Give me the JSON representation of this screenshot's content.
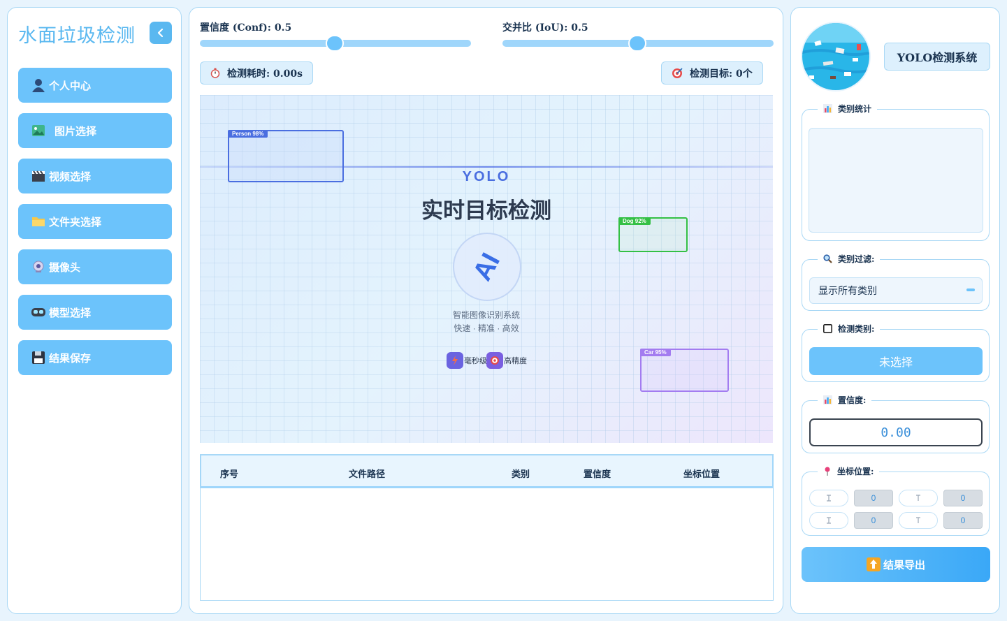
{
  "sidebar": {
    "title": "水面垃圾检测",
    "items": [
      {
        "label": "个人中心",
        "icon": "user-icon"
      },
      {
        "label": "图片选择",
        "icon": "image-icon"
      },
      {
        "label": "视频选择",
        "icon": "clapperboard-icon"
      },
      {
        "label": "文件夹选择",
        "icon": "folder-icon"
      },
      {
        "label": "摄像头",
        "icon": "webcam-icon"
      },
      {
        "label": "模型选择",
        "icon": "vr-headset-icon"
      },
      {
        "label": "结果保存",
        "icon": "floppy-disk-icon"
      }
    ]
  },
  "controls": {
    "conf_label": "置信度 (Conf): 0.5",
    "conf_value": 0.5,
    "iou_label": "交并比 (IoU): 0.5",
    "iou_value": 0.5,
    "time_label": "检测耗时: 0.00s",
    "target_label": "检测目标: 0个"
  },
  "viewer": {
    "heading_en": "YOLO",
    "heading_cn": "实时目标检测",
    "ai_text": "AI",
    "subtitle": "智能图像识别系统",
    "tagline": "快速 · 精准 · 高效",
    "features": [
      "毫秒级",
      "高精度"
    ],
    "boxes": [
      {
        "label": "Person 98%",
        "color": "#4a6ee0"
      },
      {
        "label": "Dog 92%",
        "color": "#34c045"
      },
      {
        "label": "Car 95%",
        "color": "#a37cf0"
      }
    ]
  },
  "table": {
    "headers": [
      "序号",
      "文件路径",
      "类别",
      "置信度",
      "坐标位置"
    ],
    "rows": []
  },
  "right": {
    "system_title": "YOLO检测系统",
    "class_stats_label": "类别统计",
    "class_filter_label": "类别过滤:",
    "class_filter_value": "显示所有类别",
    "detect_class_label": "检测类别:",
    "detect_class_value": "未选择",
    "confidence_label": "置信度:",
    "confidence_value": "0.00",
    "coords_label": "坐标位置:",
    "coords": {
      "xmin": "0",
      "ymin": "0",
      "xmax": "0",
      "ymax": "0"
    },
    "export_label": "结果导出"
  },
  "colors": {
    "accent": "#6cc3fb",
    "accent_dark": "#5ab8f0",
    "panel_border": "#a9d8f5",
    "background": "#e8f4fd"
  }
}
